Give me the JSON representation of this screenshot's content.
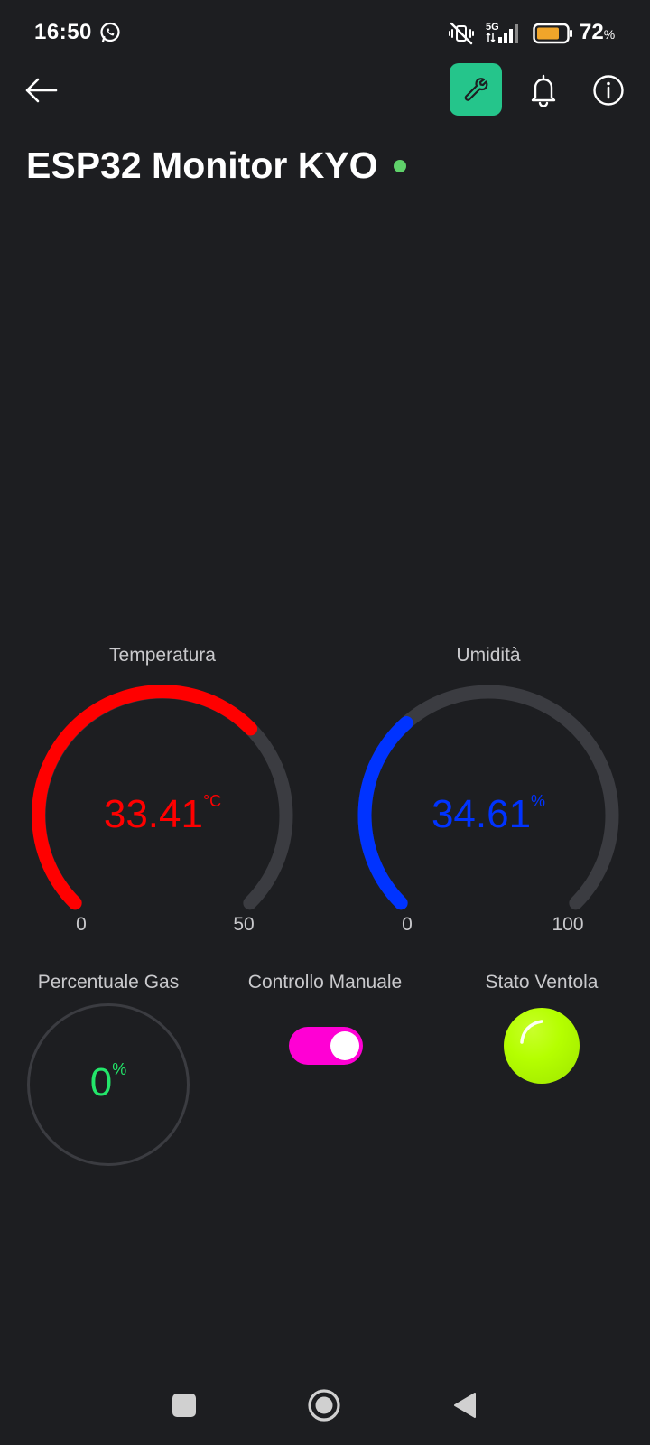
{
  "status_bar": {
    "time": "16:50",
    "network": "5G",
    "battery_level": "72",
    "battery_unit": "%",
    "icons": [
      "whatsapp-icon",
      "mute-icon",
      "signal-icon",
      "battery-icon"
    ]
  },
  "top_bar": {
    "icons": [
      "back-arrow-icon",
      "wrench-icon",
      "bell-icon",
      "info-icon"
    ],
    "accent_color": "#25c58b"
  },
  "device": {
    "title": "ESP32 Monitor KYO",
    "online_color": "#5fd16a"
  },
  "gauges": [
    {
      "label": "Temperatura",
      "value": "33.41",
      "unit": "°C",
      "min": "0",
      "max": "50",
      "fill_fraction": 0.6682,
      "color": "#ff0000"
    },
    {
      "label": "Umidità",
      "value": "34.61",
      "unit": "%",
      "min": "0",
      "max": "100",
      "fill_fraction": 0.3461,
      "color": "#0033ff"
    }
  ],
  "widgets": {
    "gas": {
      "label": "Percentuale Gas",
      "value": "0",
      "unit": "%",
      "color": "#23e66a"
    },
    "manual_control": {
      "label": "Controllo Manuale",
      "state": "on",
      "color": "#ff00d4"
    },
    "fan_status": {
      "label": "Stato Ventola",
      "state": "on",
      "color": "#b5ff00"
    }
  },
  "nav_bar": {
    "icons": [
      "recents-square-icon",
      "home-circle-icon",
      "back-triangle-icon"
    ]
  }
}
